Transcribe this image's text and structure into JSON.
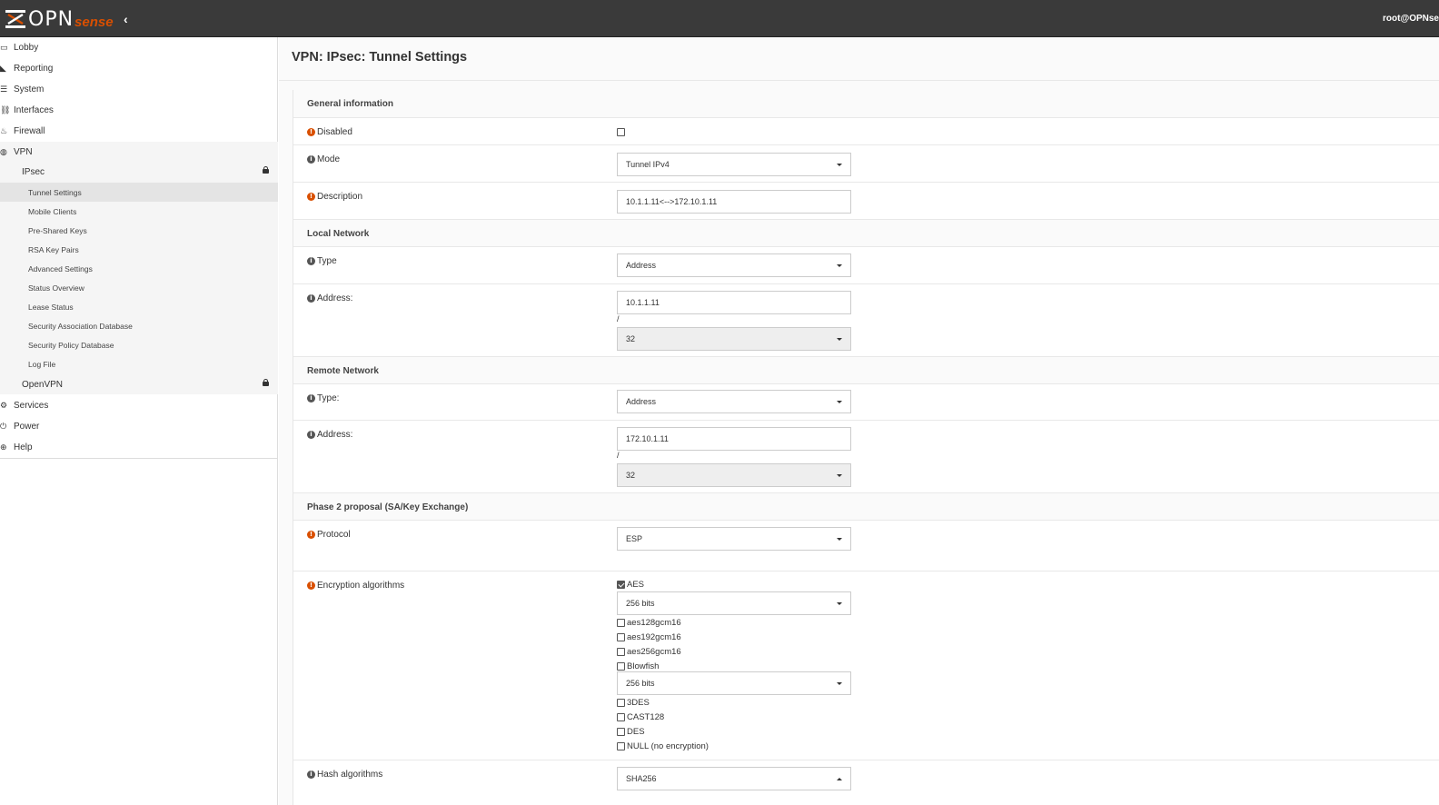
{
  "header": {
    "logo_opn": "OPN",
    "logo_sense": "sense",
    "user": "root@OPNse"
  },
  "sidebar": {
    "items": [
      {
        "label": "Lobby",
        "icon": "laptop-icon"
      },
      {
        "label": "Reporting",
        "icon": "area-chart-icon"
      },
      {
        "label": "System",
        "icon": "server-icon"
      },
      {
        "label": "Interfaces",
        "icon": "sitemap-icon"
      },
      {
        "label": "Firewall",
        "icon": "fire-icon"
      },
      {
        "label": "VPN",
        "icon": "globe-icon"
      }
    ],
    "vpn_groups": {
      "ipsec": "IPsec",
      "openvpn": "OpenVPN"
    },
    "ipsec_items": [
      "Tunnel Settings",
      "Mobile Clients",
      "Pre-Shared Keys",
      "RSA Key Pairs",
      "Advanced Settings",
      "Status Overview",
      "Lease Status",
      "Security Association Database",
      "Security Policy Database",
      "Log File"
    ],
    "bottom_items": [
      {
        "label": "Services",
        "icon": "cog-icon"
      },
      {
        "label": "Power",
        "icon": "plug-icon"
      },
      {
        "label": "Help",
        "icon": "support-icon"
      }
    ]
  },
  "page": {
    "title": "VPN: IPsec: Tunnel Settings"
  },
  "form": {
    "general": {
      "heading": "General information",
      "disabled_label": "Disabled",
      "disabled_checked": false,
      "mode_label": "Mode",
      "mode_value": "Tunnel IPv4",
      "description_label": "Description",
      "description_value": "10.1.1.11<-->172.10.1.11"
    },
    "local": {
      "heading": "Local Network",
      "type_label": "Type",
      "type_value": "Address",
      "address_label": "Address:",
      "address_value": "10.1.1.11",
      "slash": "/",
      "mask_value": "32"
    },
    "remote": {
      "heading": "Remote Network",
      "type_label": "Type:",
      "type_value": "Address",
      "address_label": "Address:",
      "address_value": "172.10.1.11",
      "slash": "/",
      "mask_value": "32"
    },
    "phase2": {
      "heading": "Phase 2 proposal (SA/Key Exchange)",
      "protocol_label": "Protocol",
      "protocol_value": "ESP",
      "enc_label": "Encryption algorithms",
      "aes_label": "AES",
      "aes_checked": true,
      "aes_bits": "256 bits",
      "aes128": "aes128gcm16",
      "aes192": "aes192gcm16",
      "aes256": "aes256gcm16",
      "blowfish": "Blowfish",
      "blowfish_bits": "256 bits",
      "des3": "3DES",
      "cast128": "CAST128",
      "des": "DES",
      "null": "NULL (no encryption)",
      "hash_label": "Hash algorithms",
      "hash_value": "SHA256"
    }
  },
  "colors": {
    "topbar": "#3a3a3a",
    "accent": "#d94f00"
  }
}
